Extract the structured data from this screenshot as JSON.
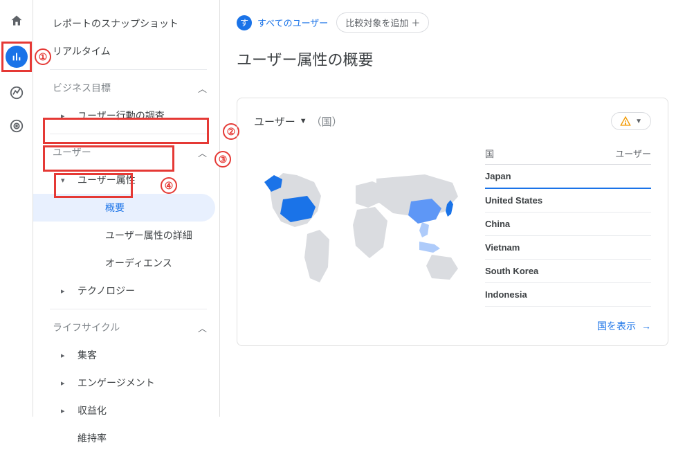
{
  "annotations": {
    "n1": "①",
    "n2": "②",
    "n3": "③",
    "n4": "④"
  },
  "nav": {
    "snapshot": "レポートのスナップショット",
    "realtime": "リアルタイム",
    "business_goals": "ビジネス目標",
    "user_behavior": "ユーザー行動の調査",
    "user": "ユーザー",
    "user_attr": "ユーザー属性",
    "overview": "概要",
    "user_attr_detail": "ユーザー属性の詳細",
    "audience": "オーディエンス",
    "technology": "テクノロジー",
    "lifecycle": "ライフサイクル",
    "acquisition": "集客",
    "engagement": "エンゲージメント",
    "monetization": "収益化",
    "retention": "維持率"
  },
  "filters": {
    "all_badge": "す",
    "all_users": "すべてのユーザー",
    "add_compare": "比較対象を追加"
  },
  "page_title": "ユーザー属性の概要",
  "card": {
    "metric": "ユーザー",
    "dimension": "（国）",
    "col_country": "国",
    "col_users": "ユーザー",
    "rows": [
      "Japan",
      "United States",
      "China",
      "Vietnam",
      "South Korea",
      "Indonesia"
    ],
    "view_countries": "国を表示"
  },
  "chart_data": {
    "type": "geo",
    "title": "ユーザー（国）",
    "metric": "ユーザー",
    "dimension": "国",
    "highlighted_regions": [
      "Japan",
      "United States",
      "China",
      "Vietnam",
      "South Korea",
      "Indonesia"
    ],
    "top_country": "Japan"
  }
}
